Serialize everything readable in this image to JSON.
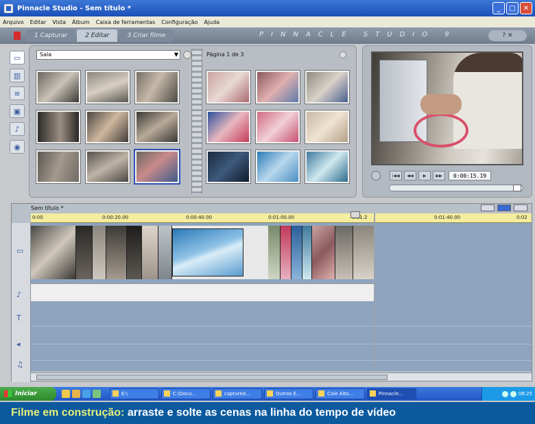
{
  "window": {
    "title": "Pinnacle Studio - Sem título *"
  },
  "menu": [
    "Arquivo",
    "Editar",
    "Vista",
    "Álbum",
    "Caixa de ferramentas",
    "Configuração",
    "Ajuda"
  ],
  "modes": [
    {
      "label": "1 Capturar"
    },
    {
      "label": "2 Editar"
    },
    {
      "label": "3 Criar filme"
    }
  ],
  "brand": "PINNACLE STUDIO 9",
  "album": {
    "combo_value": "Sala",
    "page_info": "Página 1 de 3"
  },
  "preview": {
    "timecode": "0:00:15.19"
  },
  "timeline": {
    "title": "Sem título *",
    "ruler_marks": [
      "0:00",
      "0:00:20.00",
      "0:00:40.00",
      "0:01:00.00",
      "0:01:2",
      "0:01:40.00",
      "0:02"
    ]
  },
  "taskbar": {
    "start": "Iniciar",
    "tasks": [
      "E:\\",
      "C:\\Docu...",
      "captured...",
      "Outros E...",
      "Cole Alto...",
      "Pinnacle..."
    ],
    "clock": "08:25"
  },
  "caption": {
    "lead": "Filme em construção:",
    "text": " arraste e solte as cenas na linha do tempo de vídeo"
  },
  "colors": {
    "timeline_track": "#8ea4bf",
    "ruler": "#f4ec9e",
    "caption_bg": "#0c5a9e",
    "caption_lead": "#e6f07a"
  }
}
